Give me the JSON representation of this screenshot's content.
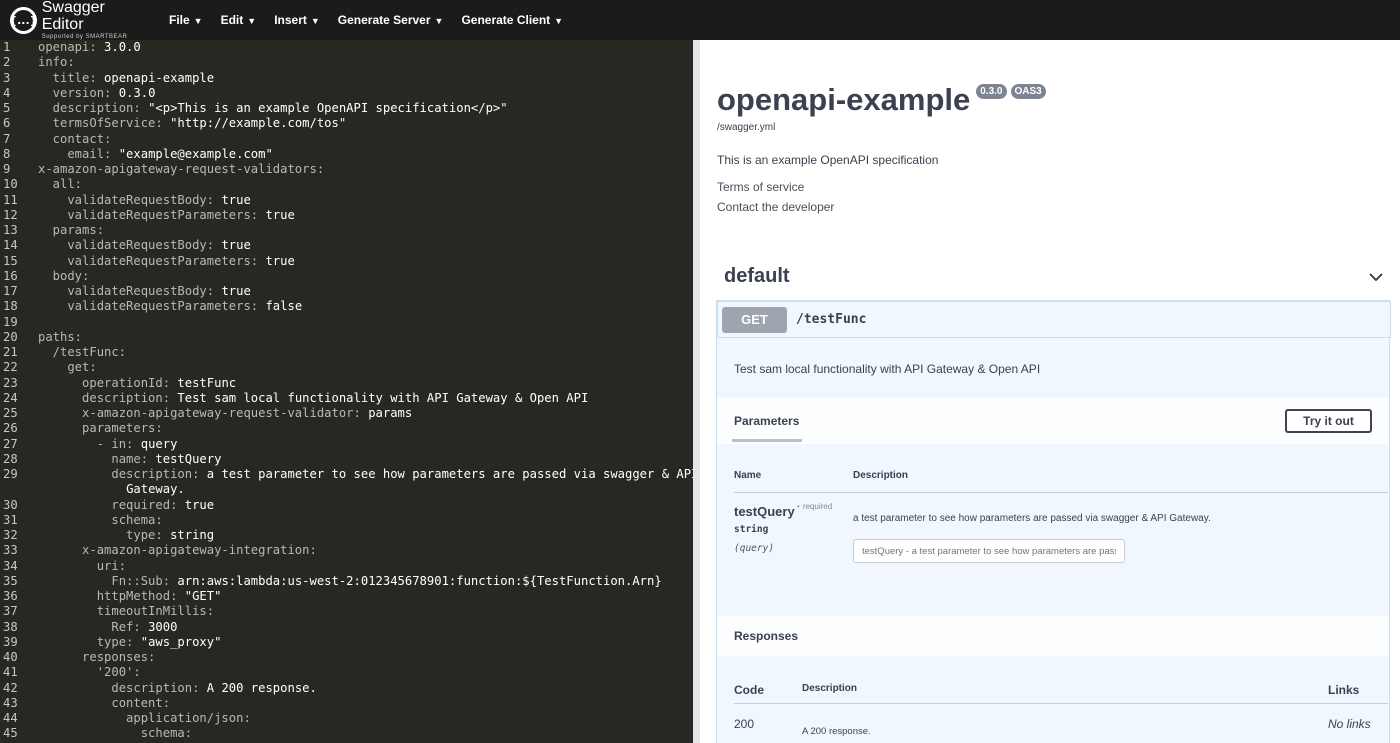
{
  "app": {
    "logo_title": "Swagger Editor",
    "logo_sub": "Supported by SMARTBEAR",
    "logo_glyph": "{...}"
  },
  "menu": [
    {
      "label": "File"
    },
    {
      "label": "Edit"
    },
    {
      "label": "Insert"
    },
    {
      "label": "Generate Server"
    },
    {
      "label": "Generate Client"
    }
  ],
  "editor_lines": [
    {
      "n": "1",
      "k": "openapi: ",
      "v": "3.0.0"
    },
    {
      "n": "2",
      "k": "info:",
      "v": ""
    },
    {
      "n": "3",
      "k": "  title: ",
      "v": "openapi-example"
    },
    {
      "n": "4",
      "k": "  version: ",
      "v": "0.3.0"
    },
    {
      "n": "5",
      "k": "  description: ",
      "v": "\"<p>This is an example OpenAPI specification</p>\""
    },
    {
      "n": "6",
      "k": "  termsOfService: ",
      "v": "\"http://example.com/tos\""
    },
    {
      "n": "7",
      "k": "  contact:",
      "v": ""
    },
    {
      "n": "8",
      "k": "    email: ",
      "v": "\"example@example.com\""
    },
    {
      "n": "9",
      "k": "x-amazon-apigateway-request-validators:",
      "v": ""
    },
    {
      "n": "10",
      "k": "  all:",
      "v": ""
    },
    {
      "n": "11",
      "k": "    validateRequestBody: ",
      "v": "true"
    },
    {
      "n": "12",
      "k": "    validateRequestParameters: ",
      "v": "true"
    },
    {
      "n": "13",
      "k": "  params:",
      "v": ""
    },
    {
      "n": "14",
      "k": "    validateRequestBody: ",
      "v": "true"
    },
    {
      "n": "15",
      "k": "    validateRequestParameters: ",
      "v": "true"
    },
    {
      "n": "16",
      "k": "  body:",
      "v": ""
    },
    {
      "n": "17",
      "k": "    validateRequestBody: ",
      "v": "true"
    },
    {
      "n": "18",
      "k": "    validateRequestParameters: ",
      "v": "false"
    },
    {
      "n": "19",
      "k": "",
      "v": ""
    },
    {
      "n": "20",
      "k": "paths:",
      "v": ""
    },
    {
      "n": "21",
      "k": "  /testFunc:",
      "v": ""
    },
    {
      "n": "22",
      "k": "    get:",
      "v": ""
    },
    {
      "n": "23",
      "k": "      operationId: ",
      "v": "testFunc"
    },
    {
      "n": "24",
      "k": "      description: ",
      "v": "Test sam local functionality with API Gateway & Open API"
    },
    {
      "n": "25",
      "k": "      x-amazon-apigateway-request-validator: ",
      "v": "params"
    },
    {
      "n": "26",
      "k": "      parameters:",
      "v": ""
    },
    {
      "n": "27",
      "k": "        - in: ",
      "v": "query"
    },
    {
      "n": "28",
      "k": "          name: ",
      "v": "testQuery"
    },
    {
      "n": "29",
      "k": "          description: ",
      "v": "a test parameter to see how parameters are passed via swagger & API"
    },
    {
      "n": "",
      "k": "            ",
      "v": "Gateway."
    },
    {
      "n": "30",
      "k": "          required: ",
      "v": "true"
    },
    {
      "n": "31",
      "k": "          schema:",
      "v": ""
    },
    {
      "n": "32",
      "k": "            type: ",
      "v": "string"
    },
    {
      "n": "33",
      "k": "      x-amazon-apigateway-integration:",
      "v": ""
    },
    {
      "n": "34",
      "k": "        uri:",
      "v": ""
    },
    {
      "n": "35",
      "k": "          Fn::Sub: ",
      "v": "arn:aws:lambda:us-west-2:012345678901:function:${TestFunction.Arn}"
    },
    {
      "n": "36",
      "k": "        httpMethod: ",
      "v": "\"GET\""
    },
    {
      "n": "37",
      "k": "        timeoutInMillis:",
      "v": ""
    },
    {
      "n": "38",
      "k": "          Ref: ",
      "v": "3000"
    },
    {
      "n": "39",
      "k": "        type: ",
      "v": "\"aws_proxy\""
    },
    {
      "n": "40",
      "k": "      responses:",
      "v": ""
    },
    {
      "n": "41",
      "k": "        '200':",
      "v": ""
    },
    {
      "n": "42",
      "k": "          description: ",
      "v": "A 200 response."
    },
    {
      "n": "43",
      "k": "          content:",
      "v": ""
    },
    {
      "n": "44",
      "k": "            application/json:",
      "v": ""
    },
    {
      "n": "45",
      "k": "              schema:",
      "v": ""
    }
  ],
  "preview": {
    "title": "openapi-example",
    "version_badge": "0.3.0",
    "oas_badge": "OAS3",
    "url": "/swagger.yml",
    "description": "This is an example OpenAPI specification",
    "terms_link": "Terms of service",
    "contact_link": "Contact the developer",
    "tag": "default",
    "operation": {
      "method": "GET",
      "path": "/testFunc",
      "description": "Test sam local functionality with API Gateway & Open API",
      "parameters_tab": "Parameters",
      "try_button": "Try it out",
      "col_name": "Name",
      "col_description": "Description",
      "param": {
        "name": "testQuery",
        "required": "required",
        "type": "string",
        "in": "(query)",
        "description": "a test parameter to see how parameters are passed via swagger & API Gateway.",
        "placeholder": "testQuery - a test parameter to see how parameters are passed via swagger & API Gateway."
      },
      "responses_title": "Responses",
      "resp_col_code": "Code",
      "resp_col_description": "Description",
      "resp_col_links": "Links",
      "response": {
        "code": "200",
        "description": "A 200 response.",
        "links": "No links"
      }
    }
  }
}
